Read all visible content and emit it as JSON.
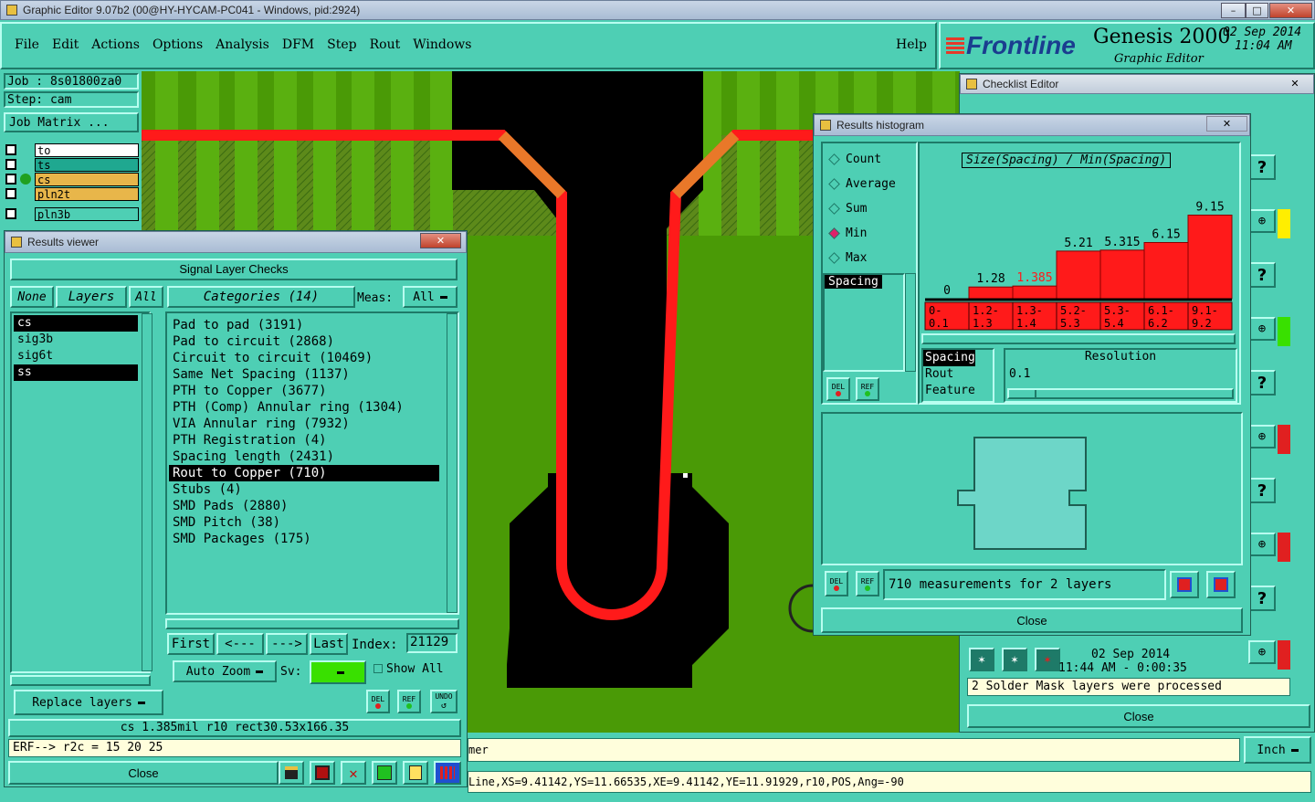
{
  "app": {
    "title": "Graphic Editor 9.07b2 (00@HY-HYCAM-PC041 - Windows, pid:2924)",
    "brand": "Frontline",
    "product": "Genesis 2000",
    "subtitle": "Graphic Editor",
    "date": "02  Sep  2014",
    "time": "11:04  AM"
  },
  "menu": [
    "File",
    "Edit",
    "Actions",
    "Options",
    "Analysis",
    "DFM",
    "Step",
    "Rout",
    "Windows"
  ],
  "help": "Help",
  "job": {
    "job_label": "Job  :  8s01800za0",
    "step_label": "Step:  cam",
    "matrix_button": "Job Matrix ..."
  },
  "layers": [
    {
      "name": "to",
      "color": "#ffffff"
    },
    {
      "name": "ts",
      "color": "#1fa890"
    },
    {
      "name": "cs",
      "color": "#e8b64a"
    },
    {
      "name": "pln2t",
      "color": "#e8b64a"
    },
    {
      "name": "pln3b",
      "color": "#4ecfb4"
    }
  ],
  "results_viewer": {
    "title": "Results viewer",
    "header": "Signal Layer Checks",
    "none": "None",
    "layers_btn": "Layers",
    "all": "All",
    "categories": "Categories (14)",
    "meas_label": "Meas:",
    "meas_value": "All",
    "layer_list": [
      {
        "name": "cs",
        "selected": true
      },
      {
        "name": "sig3b",
        "selected": false
      },
      {
        "name": "sig6t",
        "selected": false
      },
      {
        "name": "ss",
        "selected": true
      }
    ],
    "category_list": [
      {
        "name": "Pad to pad (3191)",
        "selected": false
      },
      {
        "name": "Pad to circuit (2868)",
        "selected": false
      },
      {
        "name": "Circuit to circuit (10469)",
        "selected": false
      },
      {
        "name": "Same Net Spacing (1137)",
        "selected": false
      },
      {
        "name": "PTH to Copper (3677)",
        "selected": false
      },
      {
        "name": "PTH (Comp) Annular ring (1304)",
        "selected": false
      },
      {
        "name": "VIA Annular ring (7932)",
        "selected": false
      },
      {
        "name": "PTH Registration (4)",
        "selected": false
      },
      {
        "name": "Spacing length (2431)",
        "selected": false
      },
      {
        "name": "Rout to Copper (710)",
        "selected": true
      },
      {
        "name": "Stubs (4)",
        "selected": false
      },
      {
        "name": "SMD Pads (2880)",
        "selected": false
      },
      {
        "name": "SMD Pitch (38)",
        "selected": false
      },
      {
        "name": "SMD Packages (175)",
        "selected": false
      }
    ],
    "first": "First",
    "prev": "<---",
    "next": "--->",
    "last": "Last",
    "index_label": "Index:",
    "index_value": "21129",
    "auto_zoom": "Auto Zoom",
    "sv_label": "Sv:",
    "show_all": "Show All",
    "replace_layers": "Replace layers",
    "del": "DEL",
    "ref": "REF",
    "undo": "UNDO",
    "status": "cs  1.385mil   r10   rect30.53x166.35",
    "erf": "ERF--> r2c = 15 20 25",
    "close": "Close"
  },
  "histogram": {
    "title": "Results histogram",
    "options": [
      {
        "name": "Count",
        "checked": false
      },
      {
        "name": "Average",
        "checked": false
      },
      {
        "name": "Sum",
        "checked": false
      },
      {
        "name": "Min",
        "checked": true
      },
      {
        "name": "Max",
        "checked": false
      }
    ],
    "list_item": "Spacing",
    "chart_title": "Size(Spacing) / Min(Spacing)",
    "res_items": [
      "Spacing",
      "Rout",
      "Feature"
    ],
    "resolution_label": "Resolution",
    "resolution_value": "0.1",
    "measurements": "710 measurements for 2 layers",
    "close": "Close",
    "del": "DEL",
    "ref": "REF"
  },
  "chart_data": {
    "type": "bar",
    "title": "Size(Spacing) / Min(Spacing)",
    "categories": [
      "0-\n0.1",
      "1.2-\n1.3",
      "1.3-\n1.4",
      "5.2-\n5.3",
      "5.3-\n5.4",
      "6.1-\n6.2",
      "9.1-\n9.2"
    ],
    "values": [
      0,
      1.28,
      1.385,
      5.21,
      5.315,
      6.15,
      9.15
    ],
    "value_labels": [
      "0",
      "1.28",
      "1.385",
      "5.21",
      "5.315",
      "6.15",
      "9.15"
    ],
    "highlight_index": 2,
    "bar_color": "#ff1a1a",
    "ylim": [
      0,
      10
    ]
  },
  "checklist": {
    "title": "Checklist Editor",
    "date": "02  Sep  2014",
    "time": "11:44  AM  -  0:00:35",
    "message": "2  Solder Mask layers were processed",
    "close": "Close"
  },
  "bottom": {
    "text1": "mer",
    "unit": "Inch",
    "coords": "Line,XS=9.41142,YS=11.66535,XE=9.41142,YE=11.91929,r10,POS,Ang=-90"
  }
}
